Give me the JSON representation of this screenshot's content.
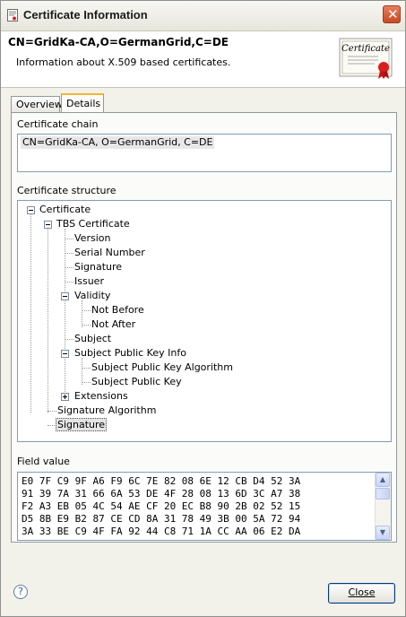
{
  "window": {
    "title": "Certificate Information"
  },
  "header": {
    "title": "CN=GridKa-CA,O=GermanGrid,C=DE",
    "description": "Information about X.509 based certificates."
  },
  "tabs": [
    {
      "label": "Overview"
    },
    {
      "label": "Details"
    }
  ],
  "details": {
    "chain_label": "Certificate chain",
    "chain_items": [
      "CN=GridKa-CA, O=GermanGrid, C=DE"
    ],
    "structure_label": "Certificate structure",
    "tree": {
      "certificate": "Certificate",
      "tbs": "TBS Certificate",
      "version": "Version",
      "serial": "Serial Number",
      "signature": "Signature",
      "issuer": "Issuer",
      "validity": "Validity",
      "not_before": "Not Before",
      "not_after": "Not After",
      "subject": "Subject",
      "spki": "Subject Public Key Info",
      "spki_alg": "Subject Public Key Algorithm",
      "spki_key": "Subject Public Key",
      "extensions": "Extensions",
      "sig_alg": "Signature Algorithm",
      "sig": "Signature"
    },
    "field_label": "Field value",
    "field_value_lines": [
      "E0 7F C9 9F A6 F9 6C 7E 82 08 6E 12 CB D4 52 3A",
      "91 39 7A 31 66 6A 53 DE 4F 28 08 13 6D 3C A7 38",
      "F2 A3 EB 05 4C 54 AE CF 20 EC B8 90 2B 02 52 15",
      "D5 8B E9 B2 87 CE CD 8A 31 78 49 3B 00 5A 72 94",
      "3A 33 BE C9 4F FA 92 44 C8 71 1A CC AA 06 E2 DA"
    ]
  },
  "buttons": {
    "close": "Close",
    "help": "?"
  },
  "icons": {
    "close_window": "close-icon",
    "help": "help-icon",
    "certificate": "certificate-badge-icon"
  },
  "colors": {
    "accent_tab": "#f3b334",
    "close_red": "#c84924",
    "border_blue": "#7f9db9"
  }
}
